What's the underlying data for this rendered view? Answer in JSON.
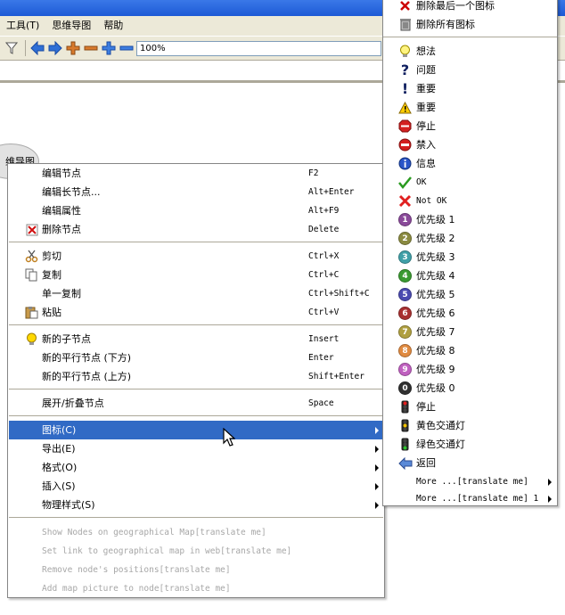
{
  "menubar": {
    "items": [
      "工具(T)",
      "思维导图",
      "帮助"
    ]
  },
  "toolbar": {
    "zoom_value": "100%"
  },
  "canvas": {
    "node_text": "维导图"
  },
  "context_menu": {
    "items": [
      {
        "label": "编辑节点",
        "shortcut": "F2",
        "icon": ""
      },
      {
        "label": "编辑长节点...",
        "shortcut": "Alt+Enter",
        "icon": ""
      },
      {
        "label": "编辑属性",
        "shortcut": "Alt+F9",
        "icon": ""
      },
      {
        "label": "删除节点",
        "shortcut": "Delete",
        "icon": "delete-node-icon"
      },
      {
        "label": "剪切",
        "shortcut": "Ctrl+X",
        "icon": "scissors-icon"
      },
      {
        "label": "复制",
        "shortcut": "Ctrl+C",
        "icon": "copy-icon"
      },
      {
        "label": "单一复制",
        "shortcut": "Ctrl+Shift+C",
        "icon": ""
      },
      {
        "label": "粘贴",
        "shortcut": "Ctrl+V",
        "icon": "paste-icon"
      },
      {
        "label": "新的子节点",
        "shortcut": "Insert",
        "icon": "lightbulb-icon"
      },
      {
        "label": "新的平行节点 (下方)",
        "shortcut": "Enter",
        "icon": ""
      },
      {
        "label": "新的平行节点 (上方)",
        "shortcut": "Shift+Enter",
        "icon": ""
      },
      {
        "label": "展开/折叠节点",
        "shortcut": "Space",
        "icon": ""
      },
      {
        "label": "图标(C)",
        "shortcut": "",
        "icon": ""
      },
      {
        "label": "导出(E)",
        "shortcut": "",
        "icon": ""
      },
      {
        "label": "格式(O)",
        "shortcut": "",
        "icon": ""
      },
      {
        "label": "插入(S)",
        "shortcut": "",
        "icon": ""
      },
      {
        "label": "物理样式(S)",
        "shortcut": "",
        "icon": ""
      },
      {
        "label": "Show Nodes on geographical Map[translate me]",
        "shortcut": "",
        "icon": ""
      },
      {
        "label": "Set link to geographical map in web[translate me]",
        "shortcut": "",
        "icon": ""
      },
      {
        "label": "Remove node's positions[translate me]",
        "shortcut": "",
        "icon": ""
      },
      {
        "label": "Add map picture to node[translate me]",
        "shortcut": "",
        "icon": ""
      }
    ]
  },
  "icons_submenu": {
    "items": [
      {
        "label": "删除最后一个图标",
        "icon": "delete-last-icon"
      },
      {
        "label": "删除所有图标",
        "icon": "trash-icon"
      },
      {
        "label": "想法",
        "icon": "idea-icon"
      },
      {
        "label": "问题",
        "icon": "question-icon"
      },
      {
        "label": "重要",
        "icon": "exclamation-icon"
      },
      {
        "label": "重要",
        "icon": "warning-icon"
      },
      {
        "label": "停止",
        "icon": "stop-sign-icon"
      },
      {
        "label": "禁入",
        "icon": "no-entry-icon"
      },
      {
        "label": "信息",
        "icon": "info-icon"
      },
      {
        "label": "OK",
        "icon": "checkmark-icon"
      },
      {
        "label": "Not OK",
        "icon": "x-mark-icon"
      },
      {
        "label": "优先级 1",
        "icon": "priority-1-icon"
      },
      {
        "label": "优先级 2",
        "icon": "priority-2-icon"
      },
      {
        "label": "优先级 3",
        "icon": "priority-3-icon"
      },
      {
        "label": "优先级 4",
        "icon": "priority-4-icon"
      },
      {
        "label": "优先级 5",
        "icon": "priority-5-icon"
      },
      {
        "label": "优先级 6",
        "icon": "priority-6-icon"
      },
      {
        "label": "优先级 7",
        "icon": "priority-7-icon"
      },
      {
        "label": "优先级 8",
        "icon": "priority-8-icon"
      },
      {
        "label": "优先级 9",
        "icon": "priority-9-icon"
      },
      {
        "label": "优先级 0",
        "icon": "priority-0-icon"
      },
      {
        "label": "停止",
        "icon": "traffic-light-red-icon"
      },
      {
        "label": "黄色交通灯",
        "icon": "traffic-light-yellow-icon"
      },
      {
        "label": "绿色交通灯",
        "icon": "traffic-light-green-icon"
      },
      {
        "label": "返回",
        "icon": "back-arrow-icon"
      },
      {
        "label": "More ...[translate me]",
        "icon": ""
      },
      {
        "label": "More ...[translate me] 1",
        "icon": ""
      }
    ]
  },
  "colors": {
    "highlight": "#316ac5",
    "menubar": "#ece9d8",
    "disabled_text": "#a7a7a7"
  }
}
